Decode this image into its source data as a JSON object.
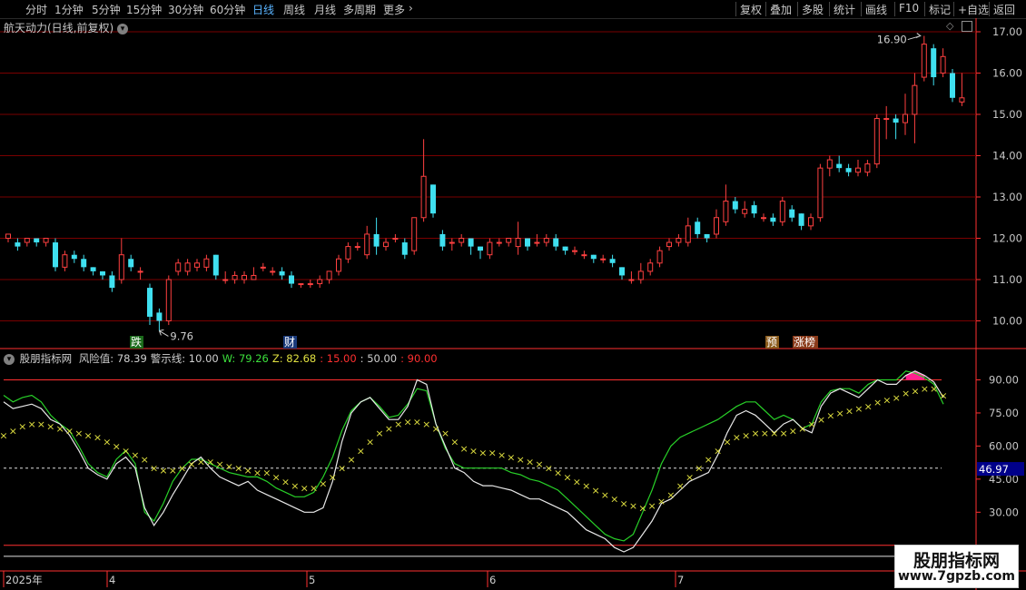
{
  "toolbar": {
    "periods": [
      "分时",
      "1分钟",
      "5分钟",
      "15分钟",
      "30分钟",
      "60分钟",
      "日线",
      "周线",
      "月线",
      "多周期",
      "更多"
    ],
    "active_period": "日线",
    "more_arrow": "›",
    "right_buttons": [
      "复权",
      "叠加",
      "多股",
      "统计",
      "画线",
      "F10",
      "标记",
      "+自选",
      "返回"
    ]
  },
  "kline": {
    "title": "航天动力(日线,前复权)",
    "title_icon": "chevron-down-icon",
    "y_ticks": [
      "17.00",
      "16.00",
      "15.00",
      "14.00",
      "13.00",
      "12.00",
      "11.00",
      "10.00"
    ],
    "high_label": "16.90",
    "low_label": "9.76",
    "markers": [
      "跌",
      "财",
      "预",
      "涨榜"
    ],
    "colors": {
      "up": "#ff4040",
      "down": "#3fe0f0",
      "grid": "#7a0000",
      "axis": "#ff3030"
    }
  },
  "indicator": {
    "name": "股朋指标网",
    "legend": [
      {
        "label": "风险值:",
        "value": "78.39",
        "color": "#d0d0d0"
      },
      {
        "label": "警示线:",
        "value": "10.00",
        "color": "#d0d0d0"
      },
      {
        "label": "W:",
        "value": "79.26",
        "color": "#3ce03c"
      },
      {
        "label": "Z:",
        "value": "82.68",
        "color": "#e0e040"
      },
      {
        "label": "",
        "value": "15.00",
        "color": "#ff3030"
      },
      {
        "label": "",
        "value": "50.00",
        "color": "#d0d0d0"
      },
      {
        "label": "",
        "value": "90.00",
        "color": "#ff3030"
      }
    ],
    "y_ticks": [
      "90.00",
      "75.00",
      "60.00",
      "45.00",
      "30.00"
    ],
    "current_value": "46.97",
    "colors": {
      "white": "#e8e8e8",
      "green": "#28d028",
      "yellow": "#e0e040",
      "red": "#ff3030",
      "pink": "#ff2090"
    }
  },
  "xaxis": {
    "labels": [
      "2025年",
      "4",
      "5",
      "6",
      "7"
    ]
  },
  "watermark": {
    "title": "股朋指标网",
    "url": "www.7gpzb.com"
  },
  "chart_data": [
    {
      "type": "candlestick",
      "title": "航天动力(日线,前复权)",
      "ylim": [
        9.6,
        17.3
      ],
      "candles": [
        [
          12.0,
          12.1,
          11.9,
          12.1
        ],
        [
          11.9,
          11.8,
          11.7,
          12.0
        ],
        [
          11.9,
          12.0,
          11.8,
          12.0
        ],
        [
          12.0,
          11.9,
          11.8,
          12.0
        ],
        [
          11.9,
          12.0,
          11.8,
          12.0
        ],
        [
          11.9,
          11.3,
          11.2,
          12.0
        ],
        [
          11.3,
          11.6,
          11.2,
          11.7
        ],
        [
          11.6,
          11.5,
          11.4,
          11.7
        ],
        [
          11.5,
          11.3,
          11.2,
          11.6
        ],
        [
          11.3,
          11.2,
          11.1,
          11.3
        ],
        [
          11.2,
          11.1,
          11.0,
          11.2
        ],
        [
          11.1,
          10.8,
          10.7,
          11.2
        ],
        [
          11.0,
          11.6,
          10.9,
          12.0
        ],
        [
          11.5,
          11.3,
          11.2,
          11.6
        ],
        [
          11.2,
          11.2,
          11.0,
          11.3
        ],
        [
          10.8,
          10.1,
          9.9,
          10.9
        ],
        [
          10.2,
          10.0,
          9.76,
          10.3
        ],
        [
          10.0,
          11.0,
          9.9,
          11.1
        ],
        [
          11.2,
          11.4,
          11.1,
          11.5
        ],
        [
          11.2,
          11.4,
          11.1,
          11.5
        ],
        [
          11.3,
          11.4,
          11.2,
          11.5
        ],
        [
          11.3,
          11.5,
          11.2,
          11.6
        ],
        [
          11.6,
          11.1,
          11.0,
          11.6
        ],
        [
          11.0,
          11.0,
          10.9,
          11.2
        ],
        [
          11.0,
          11.1,
          10.9,
          11.2
        ],
        [
          11.0,
          11.1,
          10.9,
          11.2
        ],
        [
          11.0,
          11.1,
          11.0,
          11.3
        ],
        [
          11.3,
          11.3,
          11.2,
          11.4
        ],
        [
          11.2,
          11.2,
          11.1,
          11.3
        ],
        [
          11.2,
          11.1,
          11.0,
          11.3
        ],
        [
          11.1,
          10.9,
          10.8,
          11.2
        ],
        [
          10.9,
          10.9,
          10.8,
          10.9
        ],
        [
          10.9,
          10.9,
          10.8,
          11.0
        ],
        [
          10.9,
          11.0,
          10.8,
          11.1
        ],
        [
          11.0,
          11.2,
          10.9,
          11.2
        ],
        [
          11.2,
          11.5,
          11.1,
          11.6
        ],
        [
          11.5,
          11.8,
          11.4,
          11.9
        ],
        [
          11.8,
          11.8,
          11.7,
          11.9
        ],
        [
          11.6,
          12.1,
          11.5,
          12.3
        ],
        [
          12.1,
          11.8,
          11.6,
          12.5
        ],
        [
          11.8,
          11.9,
          11.7,
          12.0
        ],
        [
          12.0,
          12.0,
          11.9,
          12.1
        ],
        [
          11.9,
          11.6,
          11.5,
          12.0
        ],
        [
          11.7,
          12.5,
          11.6,
          12.5
        ],
        [
          12.5,
          13.5,
          12.4,
          14.4
        ],
        [
          13.3,
          12.6,
          12.5,
          13.3
        ],
        [
          12.1,
          11.8,
          11.7,
          12.2
        ],
        [
          11.9,
          11.9,
          11.7,
          12.0
        ],
        [
          11.9,
          12.0,
          11.8,
          12.1
        ],
        [
          12.0,
          11.8,
          11.6,
          12.0
        ],
        [
          11.8,
          11.7,
          11.5,
          11.8
        ],
        [
          11.6,
          11.9,
          11.5,
          12.0
        ],
        [
          11.9,
          11.9,
          11.8,
          12.0
        ],
        [
          11.9,
          12.0,
          11.8,
          12.0
        ],
        [
          11.8,
          12.0,
          11.6,
          12.4
        ],
        [
          12.0,
          11.8,
          11.7,
          12.0
        ],
        [
          11.9,
          11.9,
          11.8,
          12.1
        ],
        [
          11.9,
          12.0,
          11.8,
          12.1
        ],
        [
          12.0,
          11.8,
          11.7,
          12.1
        ],
        [
          11.8,
          11.7,
          11.6,
          11.8
        ],
        [
          11.7,
          11.7,
          11.6,
          11.8
        ],
        [
          11.6,
          11.6,
          11.5,
          11.7
        ],
        [
          11.6,
          11.5,
          11.4,
          11.6
        ],
        [
          11.5,
          11.5,
          11.4,
          11.6
        ],
        [
          11.5,
          11.4,
          11.3,
          11.6
        ],
        [
          11.3,
          11.1,
          11.0,
          11.3
        ],
        [
          11.0,
          11.0,
          10.9,
          11.2
        ],
        [
          11.0,
          11.2,
          10.9,
          11.4
        ],
        [
          11.2,
          11.4,
          11.1,
          11.5
        ],
        [
          11.4,
          11.7,
          11.3,
          11.8
        ],
        [
          11.8,
          11.9,
          11.7,
          12.0
        ],
        [
          11.9,
          12.0,
          11.8,
          12.1
        ],
        [
          11.9,
          12.3,
          11.8,
          12.5
        ],
        [
          12.4,
          12.1,
          12.0,
          12.5
        ],
        [
          12.1,
          12.0,
          11.9,
          12.1
        ],
        [
          12.1,
          12.5,
          12.0,
          12.7
        ],
        [
          12.4,
          12.9,
          12.3,
          13.3
        ],
        [
          12.9,
          12.7,
          12.6,
          13.0
        ],
        [
          12.6,
          12.7,
          12.5,
          12.9
        ],
        [
          12.8,
          12.6,
          12.5,
          12.9
        ],
        [
          12.5,
          12.5,
          12.4,
          12.6
        ],
        [
          12.5,
          12.4,
          12.3,
          12.6
        ],
        [
          12.4,
          12.9,
          12.3,
          13.0
        ],
        [
          12.7,
          12.5,
          12.4,
          12.8
        ],
        [
          12.6,
          12.3,
          12.2,
          12.6
        ],
        [
          12.3,
          12.5,
          12.2,
          12.6
        ],
        [
          12.5,
          13.7,
          12.4,
          13.8
        ],
        [
          13.7,
          13.9,
          13.5,
          14.0
        ],
        [
          13.8,
          13.7,
          13.6,
          14.0
        ],
        [
          13.7,
          13.6,
          13.5,
          13.8
        ],
        [
          13.6,
          13.7,
          13.5,
          13.9
        ],
        [
          13.6,
          13.8,
          13.5,
          13.9
        ],
        [
          13.8,
          14.9,
          13.7,
          15.0
        ],
        [
          14.9,
          14.9,
          14.4,
          15.2
        ],
        [
          14.9,
          14.8,
          14.4,
          15.0
        ],
        [
          14.8,
          15.0,
          14.5,
          15.5
        ],
        [
          15.0,
          15.7,
          14.3,
          16.0
        ],
        [
          15.9,
          16.7,
          15.8,
          16.9
        ],
        [
          16.6,
          15.9,
          15.7,
          16.7
        ],
        [
          16.0,
          16.4,
          15.9,
          16.6
        ],
        [
          16.0,
          15.4,
          15.3,
          16.1
        ],
        [
          15.3,
          15.4,
          15.2,
          16.0
        ]
      ],
      "annotations": [
        "16.90",
        "9.76"
      ]
    },
    {
      "type": "line",
      "ylim": [
        10,
        100
      ],
      "series": [
        {
          "name": "风险值",
          "values": [
            80,
            77,
            78,
            79,
            77,
            72,
            70,
            65,
            58,
            50,
            47,
            45,
            52,
            55,
            50,
            32,
            24,
            30,
            38,
            45,
            52,
            55,
            50,
            46,
            44,
            42,
            44,
            40,
            38,
            36,
            34,
            32,
            30,
            30,
            32,
            44,
            62,
            75,
            80,
            82,
            77,
            72,
            72,
            78,
            90,
            88,
            70,
            60,
            50,
            48,
            44,
            42,
            42,
            41,
            40,
            38,
            36,
            36,
            34,
            32,
            30,
            26,
            22,
            20,
            18,
            14,
            12,
            14,
            20,
            26,
            34,
            36,
            40,
            44,
            46,
            48,
            56,
            66,
            74,
            76,
            74,
            70,
            66,
            70,
            72,
            68,
            66,
            78,
            84,
            86,
            84,
            82,
            86,
            90,
            88,
            88,
            92,
            94,
            92,
            89,
            82
          ]
        },
        {
          "name": "W",
          "values": [
            83,
            80,
            82,
            83,
            80,
            74,
            70,
            67,
            60,
            52,
            48,
            46,
            54,
            58,
            52,
            30,
            26,
            34,
            44,
            50,
            54,
            54,
            52,
            50,
            48,
            47,
            46,
            46,
            44,
            41,
            39,
            37,
            37,
            39,
            46,
            55,
            67,
            76,
            80,
            82,
            78,
            73,
            74,
            79,
            86,
            85,
            70,
            59,
            52,
            50,
            50,
            50,
            50,
            50,
            48,
            47,
            45,
            44,
            42,
            40,
            36,
            32,
            28,
            24,
            20,
            18,
            17,
            20,
            30,
            40,
            52,
            60,
            64,
            66,
            68,
            70,
            72,
            75,
            78,
            80,
            80,
            76,
            72,
            74,
            72,
            68,
            70,
            80,
            85,
            86,
            86,
            84,
            88,
            90,
            90,
            90,
            94,
            93,
            91,
            88,
            79
          ]
        },
        {
          "name": "Z",
          "values": [
            65,
            67,
            69,
            70,
            70,
            69,
            68,
            67,
            66,
            65,
            64,
            62,
            60,
            58,
            56,
            54,
            50,
            49,
            49,
            50,
            52,
            53,
            53,
            52,
            51,
            50,
            49,
            48,
            48,
            46,
            44,
            42,
            41,
            41,
            43,
            46,
            50,
            54,
            58,
            62,
            66,
            68,
            70,
            71,
            71,
            70,
            68,
            66,
            62,
            59,
            58,
            57,
            57,
            56,
            55,
            54,
            53,
            52,
            50,
            48,
            46,
            44,
            42,
            40,
            38,
            36,
            34,
            33,
            32,
            33,
            35,
            38,
            42,
            46,
            50,
            54,
            58,
            62,
            64,
            65,
            66,
            66,
            66,
            66,
            67,
            68,
            70,
            72,
            74,
            75,
            76,
            77,
            78,
            80,
            81,
            82,
            84,
            85,
            86,
            86,
            83
          ]
        }
      ],
      "reference_lines": [
        10,
        15,
        50,
        90
      ],
      "current_value": "46.97"
    }
  ]
}
